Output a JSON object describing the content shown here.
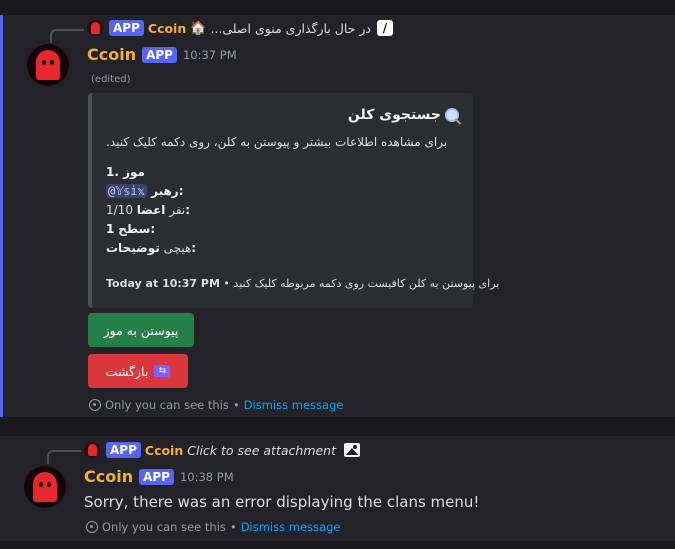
{
  "msg1": {
    "reply": {
      "badge": "APP",
      "user": "Ccoin",
      "text": "...در حال بارگذاری منوی اصلی"
    },
    "author": "Ccoin",
    "badge": "APP",
    "time": "10:37 PM",
    "edited": "(edited)",
    "embed": {
      "title": "جستجوی کلن",
      "description": "برای مشاهده اطلاعات بیشتر و پیوستن به کلن، روی دکمه کلیک کنید.",
      "clan_index": "1. موز",
      "leader_label": "رهبر:",
      "leader_value": "@𝕐𝕤𝕚𝕩",
      "members_label": "اعضا:",
      "members_value": "1/10 نفر",
      "level_label": "سطح:",
      "level_value": "1",
      "desc_label": "توضیحات:",
      "desc_value": "هیچی",
      "footer_text": "برای پیوستن به کلن کافیست روی دکمه مربوطه کلیک کنید",
      "footer_time": "Today at 10:37 PM"
    },
    "buttons": {
      "join": "پیوستن به موز",
      "back": "بازگشت"
    },
    "ephemeral": "Only you can see this",
    "dismiss": "Dismiss message"
  },
  "msg2": {
    "reply": {
      "badge": "APP",
      "user": "Ccoin",
      "text": "Click to see attachment"
    },
    "author": "Ccoin",
    "badge": "APP",
    "time": "10:38 PM",
    "body": "Sorry, there was an error displaying the clans menu!",
    "ephemeral": "Only you can see this",
    "dismiss": "Dismiss message"
  },
  "colors": {
    "accent": "#5865f2",
    "username": "#f0b232",
    "join_button": "#248046",
    "back_button": "#da373c",
    "link": "#00a8fc"
  }
}
